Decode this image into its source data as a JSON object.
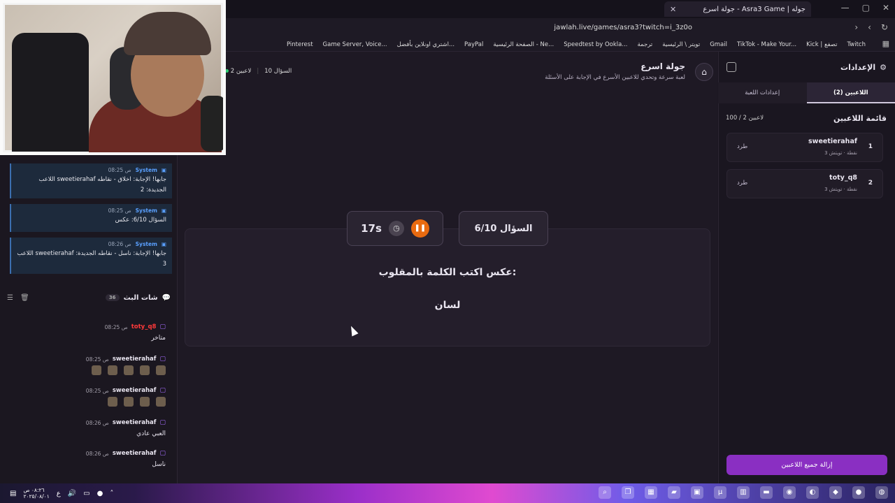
{
  "browser": {
    "tab_title": "جولة اسرع - Asra3 Game | جوله",
    "url": "jawlah.live/games/asra3?twitch=i_3z0o",
    "bookmarks": [
      "Twitch",
      "Kick | تصفع",
      "TikTok - Make Your...",
      "Gmail",
      "تويتر \\ الرئيسية",
      "ترجمة",
      "Speedtest by Ookla...",
      "الصفحة الرئيسية - Ne...",
      "PayPal",
      "اشتري اونلاين بأفضل...",
      "Game Server, Voice...",
      "Pinterest"
    ]
  },
  "game": {
    "title": "جولة اسرع",
    "subtitle": "لعبة سرعة وتحدي للاعبين الأسرع في الإجابة على الأسئلة",
    "players_count": "2 لاعبين",
    "question_label": "السؤال 10",
    "timer": "17s",
    "question_number": "السؤال 6/10",
    "question_text": "عكس اكتب الكلمة بالمقلوب:",
    "word": "لسان"
  },
  "settings": {
    "title": "الإعدادات",
    "tab_players": "اللاعبين (2)",
    "tab_game": "إعدادات اللعبة",
    "list_title": "قائمة اللاعبين",
    "list_count": "100 / 2 لاعبين",
    "players": [
      {
        "rank": "1",
        "name": "sweetierahaf",
        "meta": "3 نقطة · تويتش",
        "kick": "طرد"
      },
      {
        "rank": "2",
        "name": "toty_q8",
        "meta": "3 نقطة · تويتش",
        "kick": "طرد"
      }
    ],
    "remove_all": "إزالة جميع اللاعبين"
  },
  "system_messages": [
    {
      "who": "System",
      "time": "08:25 ص",
      "text": "اللاعب sweetierahaf جابها! الإجابة: اخلاق - نقاطه الجديدة: 2"
    },
    {
      "who": "System",
      "time": "08:25 ص",
      "text": "السؤال 6/10: عكس"
    },
    {
      "who": "System",
      "time": "08:26 ص",
      "text": "اللاعب sweetierahaf جابها! الإجابة: ناسل - نقاطه الجديدة: 3"
    }
  ],
  "chat": {
    "title": "شات البث",
    "count": "36",
    "messages": [
      {
        "user": "toty_q8",
        "time": "08:25 ص",
        "text": "متاخر"
      },
      {
        "user": "sweetierahaf",
        "time": "08:25 ص",
        "text": ""
      },
      {
        "user": "sweetierahaf",
        "time": "08:25 ص",
        "text": ""
      },
      {
        "user": "sweetierahaf",
        "time": "08:26 ص",
        "text": "العبي عادي"
      },
      {
        "user": "sweetierahaf",
        "time": "08:26 ص",
        "text": "ناسل"
      }
    ]
  },
  "taskbar": {
    "time": "٠٨:٢٦ ص",
    "date": "٢٠٢٥/٠٨/٠١"
  }
}
